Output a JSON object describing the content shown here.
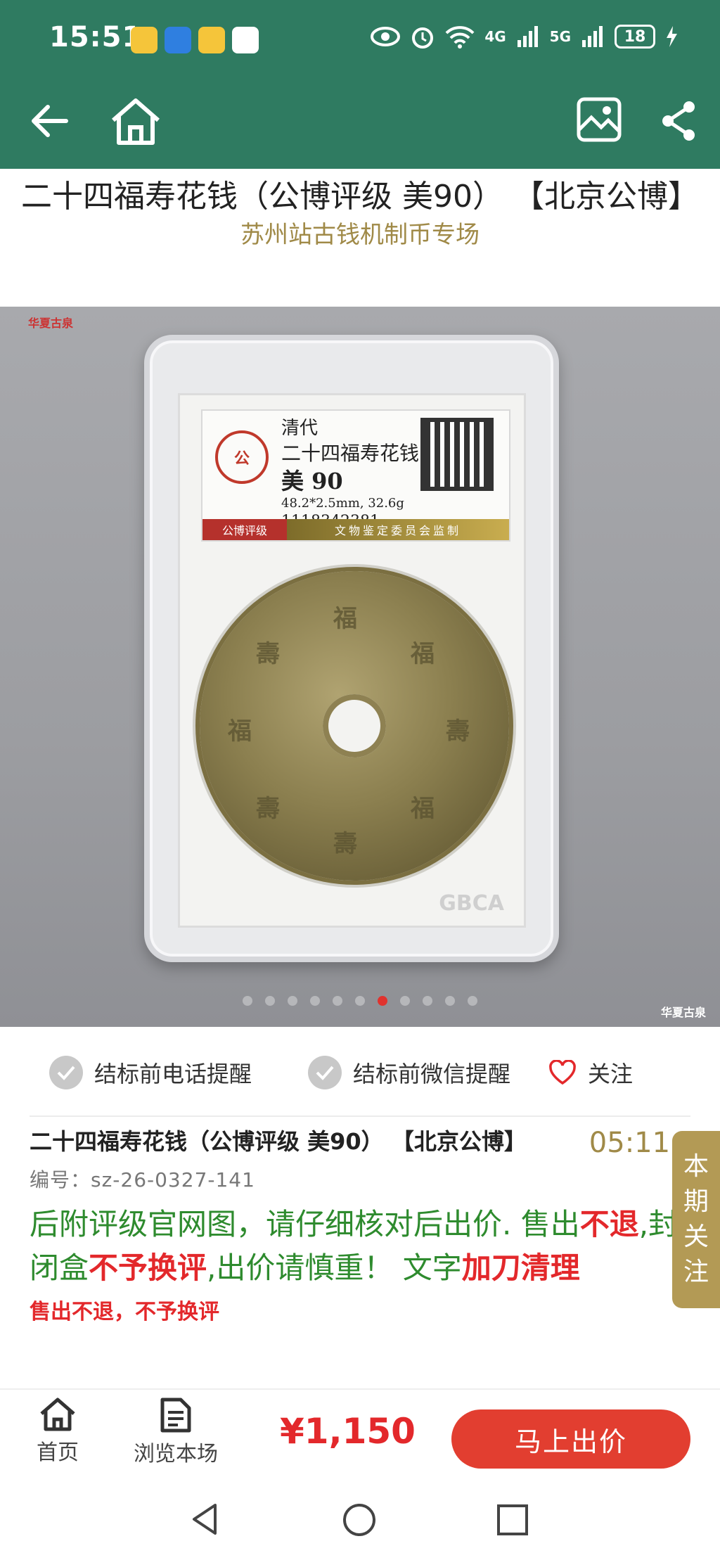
{
  "status_bar": {
    "time": "15:51",
    "signal_1": "4G",
    "signal_2": "5G",
    "battery": "18"
  },
  "header": {
    "title": "二十四福寿花钱（公博评级 美90） 【北京公博】",
    "subtitle": "苏州站古钱机制币专场"
  },
  "photo": {
    "watermark": "华夏古泉",
    "label": {
      "dynasty": "清代",
      "name": "二十四福寿花钱",
      "grade": "美 90",
      "spec": "48.2*2.5mm, 32.6g",
      "serial": "1118342381",
      "grader": "公博评级",
      "supervise": "文物鉴定委员会监制"
    },
    "slab_brand": "GBCA",
    "carousel": {
      "count": 11,
      "active": 6
    }
  },
  "reminders": {
    "phone_label": "结标前电话提醒",
    "wechat_label": "结标前微信提醒",
    "follow_label": "关注"
  },
  "lot": {
    "title": "二十四福寿花钱（公博评级 美90） 【北京公博】",
    "countdown": "05:11:3",
    "number": "编号：sz-26-0327-141",
    "desc_green_1": "后附评级官网图，请仔细核对后出价. 售出",
    "desc_red_1": "不退",
    "desc_green_2": ",封闭盒",
    "desc_red_2": "不予换评",
    "desc_green_3": ",出价请慎重！ 文字",
    "desc_red_3": "加刀清理",
    "note": "售出不退，不予换评"
  },
  "side_tab": {
    "label": [
      "本",
      "期",
      "关",
      "注"
    ]
  },
  "bottom_bar": {
    "home_label": "首页",
    "browse_label": "浏览本场",
    "price": "¥1,150",
    "bid_label": "马上出价"
  },
  "colors": {
    "primary": "#2f7b61",
    "accent": "#e23e30",
    "gold": "#a08a48",
    "green_text": "#2e8b2e"
  }
}
